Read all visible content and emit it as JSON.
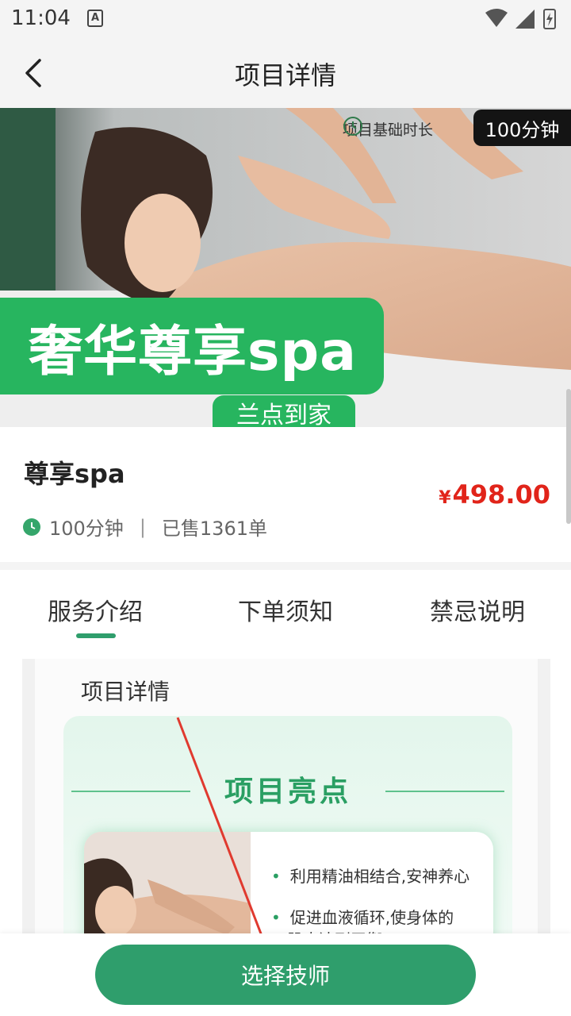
{
  "status_bar": {
    "time": "11:04",
    "notification_icon": "A"
  },
  "nav": {
    "title": "项目详情"
  },
  "hero": {
    "duration_chip_label": "项目基础时长",
    "duration_badge": "100分钟",
    "banner_text": "奢华尊享spa",
    "banner_subtext": "兰点到家",
    "accent_color": "#27b55f"
  },
  "service": {
    "name": "尊享spa",
    "price_symbol": "¥",
    "price": "498.00",
    "duration": "100分钟",
    "separator": "|",
    "sold": "已售1361单",
    "price_color": "#e1241a"
  },
  "tabs": [
    {
      "label": "服务介绍",
      "active": true
    },
    {
      "label": "下单须知",
      "active": false
    },
    {
      "label": "禁忌说明",
      "active": false
    }
  ],
  "detail": {
    "title": "项目详情",
    "highlight_title": "项目亮点",
    "bullets": [
      "利用精油相结合,安神养心",
      "促进血液循环,使身体的",
      "肌肉达到平衡"
    ]
  },
  "bottom": {
    "button_label": "选择技师",
    "button_color": "#2f9e6c"
  }
}
